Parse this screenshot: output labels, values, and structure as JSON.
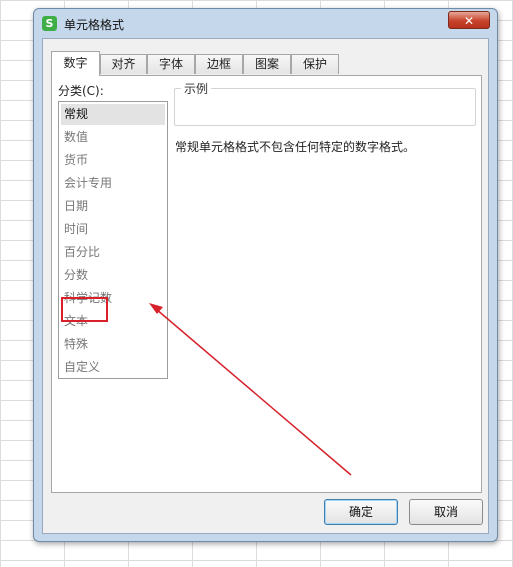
{
  "window": {
    "app_icon_glyph": "S",
    "title": "单元格格式",
    "close_glyph": "✕"
  },
  "tabs": [
    {
      "label": "数字",
      "active": true
    },
    {
      "label": "对齐"
    },
    {
      "label": "字体"
    },
    {
      "label": "边框"
    },
    {
      "label": "图案"
    },
    {
      "label": "保护"
    }
  ],
  "category": {
    "label": "分类(C):",
    "items": [
      "常规",
      "数值",
      "货币",
      "会计专用",
      "日期",
      "时间",
      "百分比",
      "分数",
      "科学记数",
      "文本",
      "特殊",
      "自定义"
    ],
    "selected": "常规",
    "highlighted": "分数"
  },
  "sample": {
    "legend": "示例"
  },
  "description": "常规单元格格式不包含任何特定的数字格式。",
  "buttons": {
    "ok": "确定",
    "cancel": "取消"
  },
  "colors": {
    "annotation_red": "#d6212a",
    "app_icon_green": "#3fae47",
    "close_red": "#c7432c"
  }
}
